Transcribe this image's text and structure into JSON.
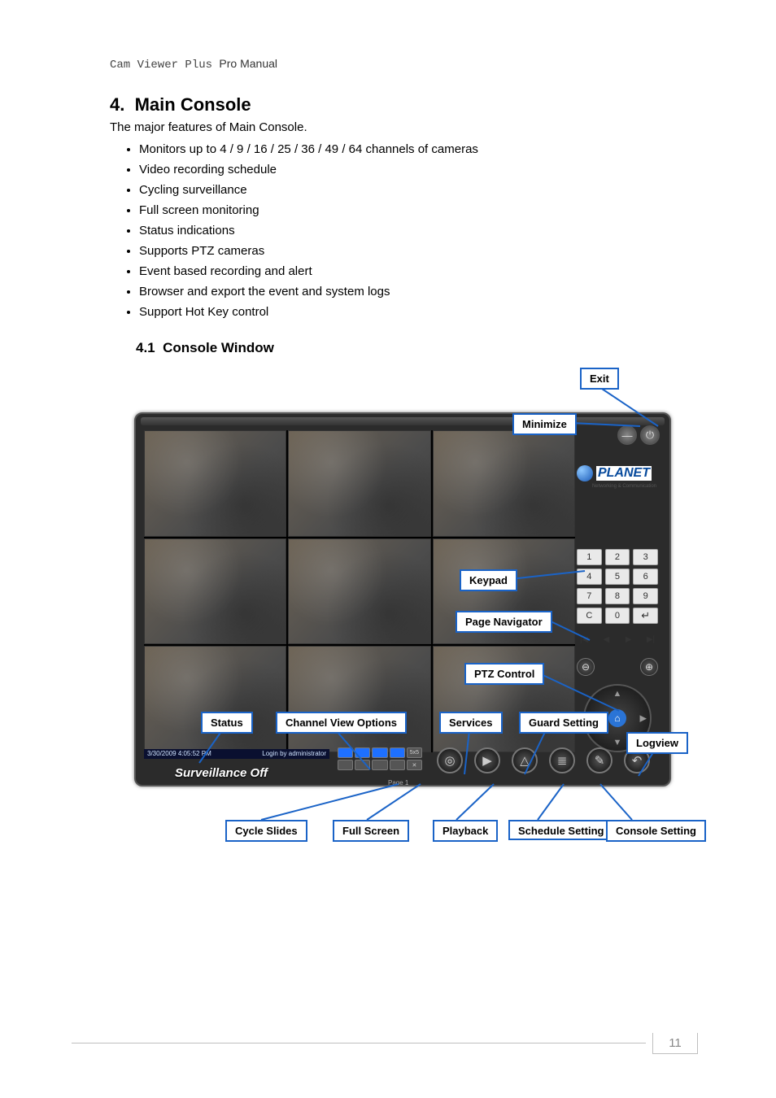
{
  "running_header": {
    "prefix": "Cam Viewer Plus ",
    "suffix": "Pro Manual"
  },
  "section": {
    "number": "4.",
    "title": "Main Console"
  },
  "intro": "The major features of Main Console.",
  "features": [
    "Monitors up to 4 / 9 / 16 / 25 / 36 / 49 / 64 channels of cameras",
    "Video recording schedule",
    "Cycling surveillance",
    "Full screen monitoring",
    "Status indications",
    "Supports PTZ cameras",
    "Event based recording and alert",
    "Browser and export the event and system logs",
    "Support Hot Key control"
  ],
  "subsection": {
    "number": "4.1",
    "title": "Console Window"
  },
  "callouts": {
    "exit": "Exit",
    "minimize": "Minimize",
    "keypad": "Keypad",
    "page_nav": "Page Navigator",
    "ptz": "PTZ Control",
    "guard": "Guard Setting",
    "services": "Services",
    "channel_view": "Channel View Options",
    "status": "Status",
    "logview": "Logview",
    "cycle": "Cycle Slides",
    "fullscreen": "Full Screen",
    "playback": "Playback",
    "schedule": "Schedule Setting",
    "console_setting": "Console Setting"
  },
  "console": {
    "brand": "PLANET",
    "brand_sub": "Networking & Communication",
    "status_time": "3/30/2009 4:05:52 PM",
    "status_msg": "Login by administrator",
    "surveillance": "Surveillance Off",
    "page_indicator": "Page 1",
    "keypad": [
      "1",
      "2",
      "3",
      "4",
      "5",
      "6",
      "7",
      "8",
      "9",
      "C",
      "0",
      "↵"
    ],
    "nav_icons": [
      "|◀",
      "◀",
      "▶",
      "▶|"
    ],
    "zoom_icons": [
      "⊖",
      "⊕"
    ],
    "home_icon": "⌂",
    "minimize_icon": "—",
    "exit_icon": "⏻",
    "grid5_label": "5x5",
    "service_icons": [
      "◎",
      "▶",
      "△",
      "≣",
      "✎",
      "↶"
    ]
  },
  "page_number": "11"
}
